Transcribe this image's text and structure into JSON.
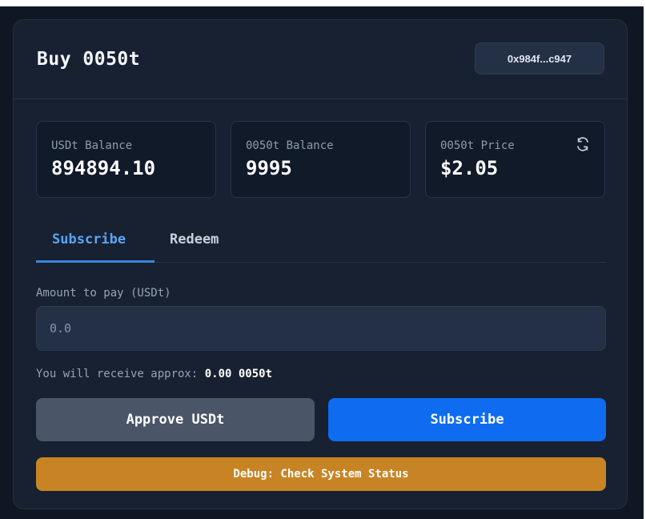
{
  "header": {
    "title": "Buy 0050t",
    "wallet_address": "0x984f...c947"
  },
  "stats": [
    {
      "label": "USDt Balance",
      "value": "894894.10"
    },
    {
      "label": "0050t Balance",
      "value": "9995"
    },
    {
      "label": "0050t Price",
      "value": "$2.05",
      "icon": "refresh-icon"
    }
  ],
  "tabs": [
    {
      "label": "Subscribe",
      "active": true
    },
    {
      "label": "Redeem",
      "active": false
    }
  ],
  "form": {
    "amount_label": "Amount to pay (USDt)",
    "amount_placeholder": "0.0",
    "receive_prefix": "You will receive approx:",
    "receive_amount": "0.00 0050t"
  },
  "actions": {
    "approve_label": "Approve USDt",
    "subscribe_label": "Subscribe",
    "debug_label": "Debug: Check System Status"
  },
  "colors": {
    "background": "#172131",
    "primary": "#0f6cf0",
    "secondary": "#4a5568",
    "warning": "#c88424",
    "active_tab": "#58a6f5"
  }
}
